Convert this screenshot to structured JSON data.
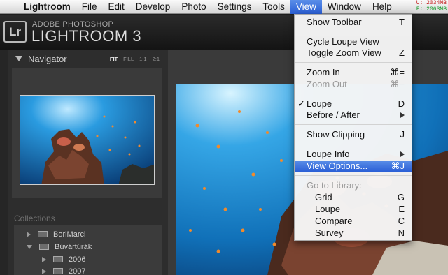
{
  "menubar": {
    "apple_icon": "apple-icon",
    "items": [
      "Lightroom",
      "File",
      "Edit",
      "Develop",
      "Photo",
      "Settings",
      "Tools",
      "View",
      "Window",
      "Help"
    ],
    "active_index": 7,
    "mem_used": "U: 2034MB",
    "mem_free": "F: 2063MB"
  },
  "header": {
    "logo": "Lr",
    "subtitle": "ADOBE PHOTOSHOP",
    "title": "LIGHTROOM 3"
  },
  "navigator": {
    "title": "Navigator",
    "zoom_options": [
      "FIT",
      "FILL",
      "1:1",
      "2:1"
    ],
    "selected_zoom": "FIT"
  },
  "collections": {
    "title": "Collections",
    "items": [
      {
        "label": "BoriMarci",
        "expanded": false
      },
      {
        "label": "Búvártúrák",
        "expanded": true
      },
      {
        "label": "2006",
        "expanded": false
      },
      {
        "label": "2007",
        "expanded": false
      }
    ]
  },
  "view_menu": {
    "items": [
      {
        "label": "Show Toolbar",
        "shortcut": "T"
      },
      {
        "label": "Cycle Loupe View",
        "shortcut": ""
      },
      {
        "label": "Toggle Zoom View",
        "shortcut": "Z"
      },
      {
        "label": "Zoom In",
        "shortcut": "⌘="
      },
      {
        "label": "Zoom Out",
        "shortcut": "⌘−"
      },
      {
        "label": "Loupe",
        "shortcut": "D",
        "checked": true
      },
      {
        "label": "Before / After",
        "shortcut": ""
      },
      {
        "label": "Show Clipping",
        "shortcut": "J"
      },
      {
        "label": "Loupe Info",
        "shortcut": ""
      },
      {
        "label": "View Options...",
        "shortcut": "⌘J"
      },
      {
        "label": "Go to Library:",
        "shortcut": ""
      },
      {
        "label": "Grid",
        "shortcut": "G"
      },
      {
        "label": "Loupe",
        "shortcut": "E"
      },
      {
        "label": "Compare",
        "shortcut": "C"
      },
      {
        "label": "Survey",
        "shortcut": "N"
      }
    ],
    "check_mark": "✓"
  },
  "colors": {
    "menu_highlight": "#2a5fd6",
    "water": "#1e8fd0",
    "reef": "#6b3a2a"
  }
}
